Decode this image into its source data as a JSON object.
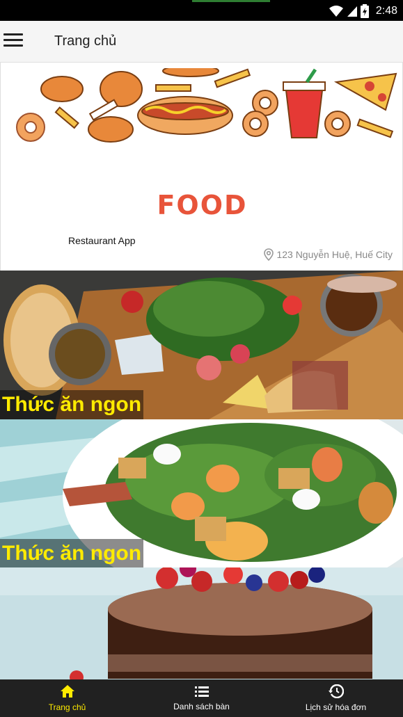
{
  "status_bar": {
    "time": "2:48"
  },
  "app_bar": {
    "title": "Trang chủ"
  },
  "header": {
    "logo_text": "FOOD",
    "app_name": "Restaurant App",
    "address": "123 Nguyễn Huệ, Huế City"
  },
  "cards": [
    {
      "label": "Thức ăn ngon"
    },
    {
      "label": "Thức ăn ngon"
    },
    {
      "label": ""
    }
  ],
  "bottom_nav": {
    "items": [
      {
        "label": "Trang chủ",
        "icon": "home-icon",
        "active": true
      },
      {
        "label": "Danh sách bàn",
        "icon": "list-icon",
        "active": false
      },
      {
        "label": "Lịch sử hóa đơn",
        "icon": "history-icon",
        "active": false
      }
    ]
  },
  "colors": {
    "accent": "#ffeb00",
    "nav_bg": "#212121",
    "logo": "#e8543a"
  }
}
